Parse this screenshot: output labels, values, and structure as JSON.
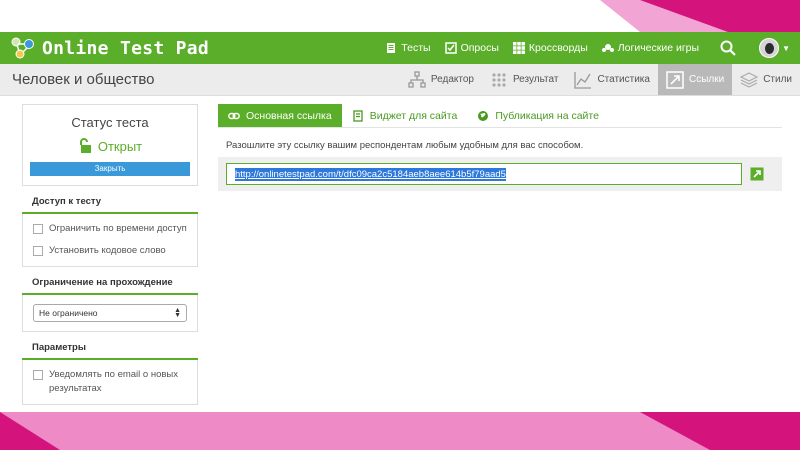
{
  "topbar": {
    "logo_text": "Online Test Pad",
    "nav": [
      {
        "label": "Тесты",
        "icon": "document-icon"
      },
      {
        "label": "Опросы",
        "icon": "poll-icon"
      },
      {
        "label": "Кроссворды",
        "icon": "grid-icon"
      },
      {
        "label": "Логические игры",
        "icon": "puzzle-icon"
      }
    ]
  },
  "subbar": {
    "title": "Человек и общество",
    "tabs": [
      {
        "label": "Редактор",
        "icon": "editor-icon"
      },
      {
        "label": "Результат",
        "icon": "result-icon"
      },
      {
        "label": "Статистика",
        "icon": "statistics-icon"
      },
      {
        "label": "Ссылки",
        "icon": "link-out-icon",
        "active": true
      },
      {
        "label": "Стили",
        "icon": "layers-icon"
      }
    ]
  },
  "status": {
    "title": "Статус теста",
    "value": "Открыт",
    "close_label": "Закрыть"
  },
  "access": {
    "heading": "Доступ к тесту",
    "options": [
      "Ограничить по времени доступ",
      "Установить кодовое слово"
    ]
  },
  "limit": {
    "heading": "Ограничение на прохождение",
    "selected": "Не ограничено"
  },
  "params": {
    "heading": "Параметры",
    "options": [
      "Уведомлять по email о новых результатах"
    ]
  },
  "tabs": {
    "main": "Основная ссылка",
    "widget": "Виджет для сайта",
    "publish": "Публикация на сайте"
  },
  "link": {
    "hint": "Разошлите эту ссылку вашим респондентам любым удобным для вас способом.",
    "url": "http://onlinetestpad.com/t/dfc09ca2c5184aeb8aee614b5f79aad5"
  },
  "colors": {
    "brand_green": "#5bae29",
    "button_blue": "#3a99d9",
    "slide_pink": "#d4147c"
  }
}
